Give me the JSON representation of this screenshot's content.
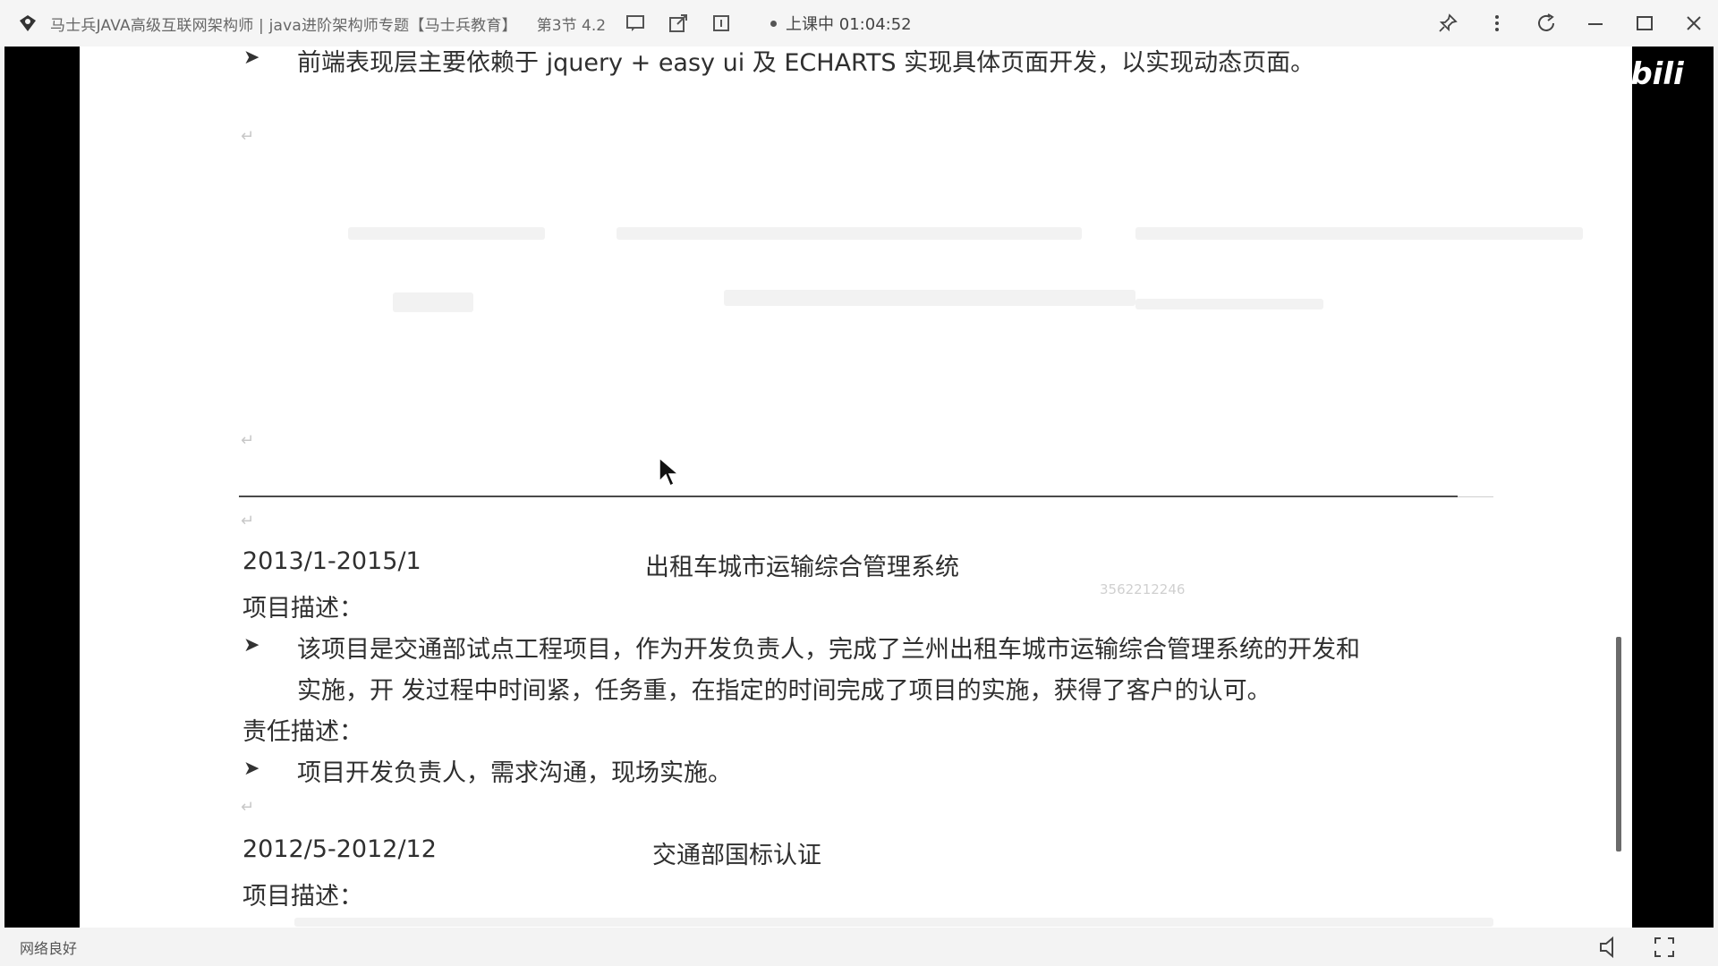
{
  "titlebar": {
    "title": "马士兵JAVA高级互联网架构师 | java进阶架构师专题【马士兵教育】",
    "lesson": "第3节 4.2",
    "status": "上课中 01:04:52"
  },
  "document": {
    "line_top": "前端表现层主要依赖于 jquery + easy ui 及 ECHARTS 实现具体页面开发，以实现动态页面。",
    "project1": {
      "date": "2013/1-2015/1",
      "name": "出租车城市运输综合管理系统",
      "desc_label": "项目描述：",
      "desc_line1": "该项目是交通部试点工程项目，作为开发负责人，完成了兰州出租车城市运输综合管理系统的开发和",
      "desc_line2": "实施，开 发过程中时间紧，任务重，在指定的时间完成了项目的实施，获得了客户的认可。",
      "resp_label": "责任描述：",
      "resp_text": "项目开发负责人，需求沟通，现场实施。"
    },
    "project2": {
      "date": "2012/5-2012/12",
      "name": "交通部国标认证",
      "desc_label": "项目描述："
    },
    "watermark": "3562212246"
  },
  "logo_text": "bili",
  "bottombar": {
    "network": "网络良好"
  },
  "icons": {
    "app": "app-logo-icon",
    "chat": "chat-icon",
    "share": "share-icon",
    "info": "info-icon",
    "pin": "pin-icon",
    "more": "more-icon",
    "refresh": "refresh-icon",
    "minimize": "minimize-icon",
    "maximize": "maximize-icon",
    "close": "close-icon",
    "volume": "volume-icon",
    "fullscreen": "fullscreen-icon"
  }
}
